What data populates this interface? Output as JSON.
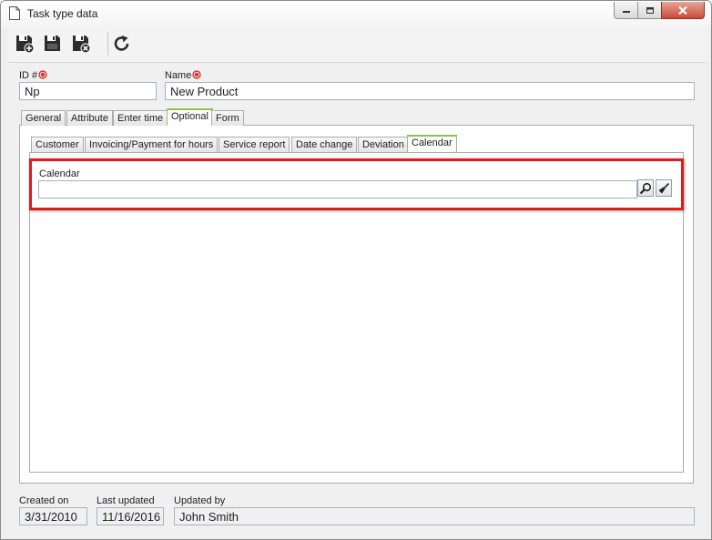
{
  "window": {
    "title": "Task type data",
    "controls": {
      "minimize_icon": "minimize-icon",
      "maximize_icon": "maximize-icon",
      "close_icon": "close-icon"
    }
  },
  "toolbar": {
    "buttons": [
      {
        "icon": "save-new-icon"
      },
      {
        "icon": "save-icon"
      },
      {
        "icon": "save-close-icon"
      },
      {
        "icon": "refresh-icon"
      }
    ]
  },
  "header_fields": {
    "id": {
      "label": "ID #",
      "value": "Np"
    },
    "name": {
      "label": "Name",
      "value": "New Product"
    }
  },
  "main_tabs": [
    "General",
    "Attribute",
    "Enter time",
    "Optional",
    "Form"
  ],
  "main_tab_active": "Optional",
  "sub_tabs": [
    "Customer",
    "Invoicing/Payment for hours",
    "Service report",
    "Date change",
    "Deviation",
    "Calendar"
  ],
  "sub_tab_active": "Calendar",
  "calendar": {
    "label": "Calendar",
    "value": "",
    "search_icon": "search-icon",
    "clear_icon": "broom-icon"
  },
  "footer": {
    "created_on": {
      "label": "Created on",
      "value": "3/31/2010"
    },
    "last_updated": {
      "label": "Last updated",
      "value": "11/16/2016"
    },
    "updated_by": {
      "label": "Updated by",
      "value": "John Smith"
    }
  },
  "colors": {
    "highlight": "#e11a1a",
    "active_tab_accent": "#8fbf4f",
    "input_border": "#9fb2c7",
    "required_marker": "#d42020"
  }
}
